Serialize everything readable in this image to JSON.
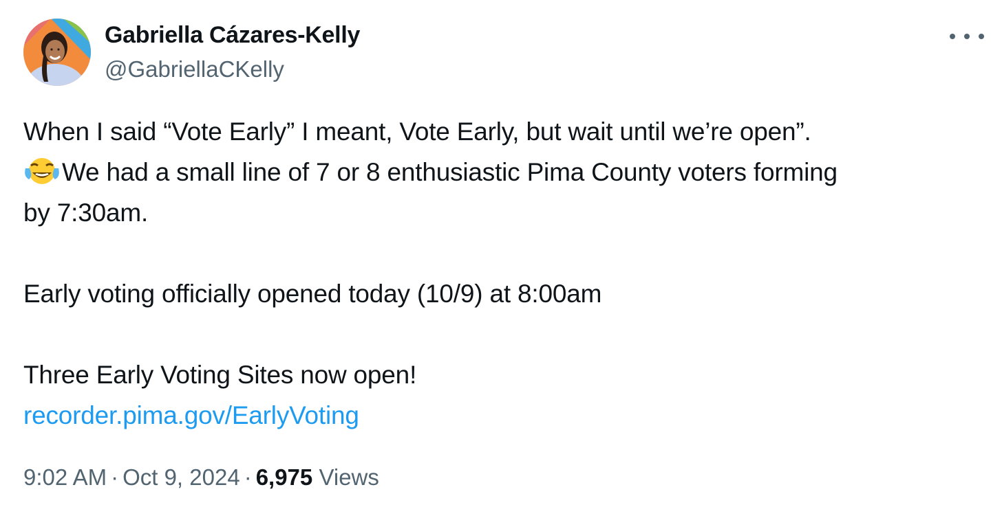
{
  "author": {
    "name": "Gabriella Cázares-Kelly",
    "handle": "@GabriellaCKelly"
  },
  "tweet": {
    "line1": "When I said “Vote Early” I meant, Vote Early, but wait until we’re open”.",
    "line2_emoji": "face-with-tears-of-joy-emoji",
    "line2": "We had a small line of 7 or 8 enthusiastic Pima County voters forming",
    "line3": "by 7:30am.",
    "line4": "Early voting officially opened today (10/9) at 8:00am",
    "line5": "Three Early Voting Sites now open!",
    "link": "recorder.pima.gov/EarlyVoting"
  },
  "meta": {
    "time": "9:02 AM",
    "separator": "·",
    "date": "Oct 9, 2024",
    "views_count": "6,975",
    "views_label": "Views"
  },
  "colors": {
    "text": "#0f1419",
    "secondary": "#536471",
    "link": "#1d9bf0"
  },
  "icons": {
    "more": "more-options-icon",
    "avatar": "profile-avatar"
  }
}
